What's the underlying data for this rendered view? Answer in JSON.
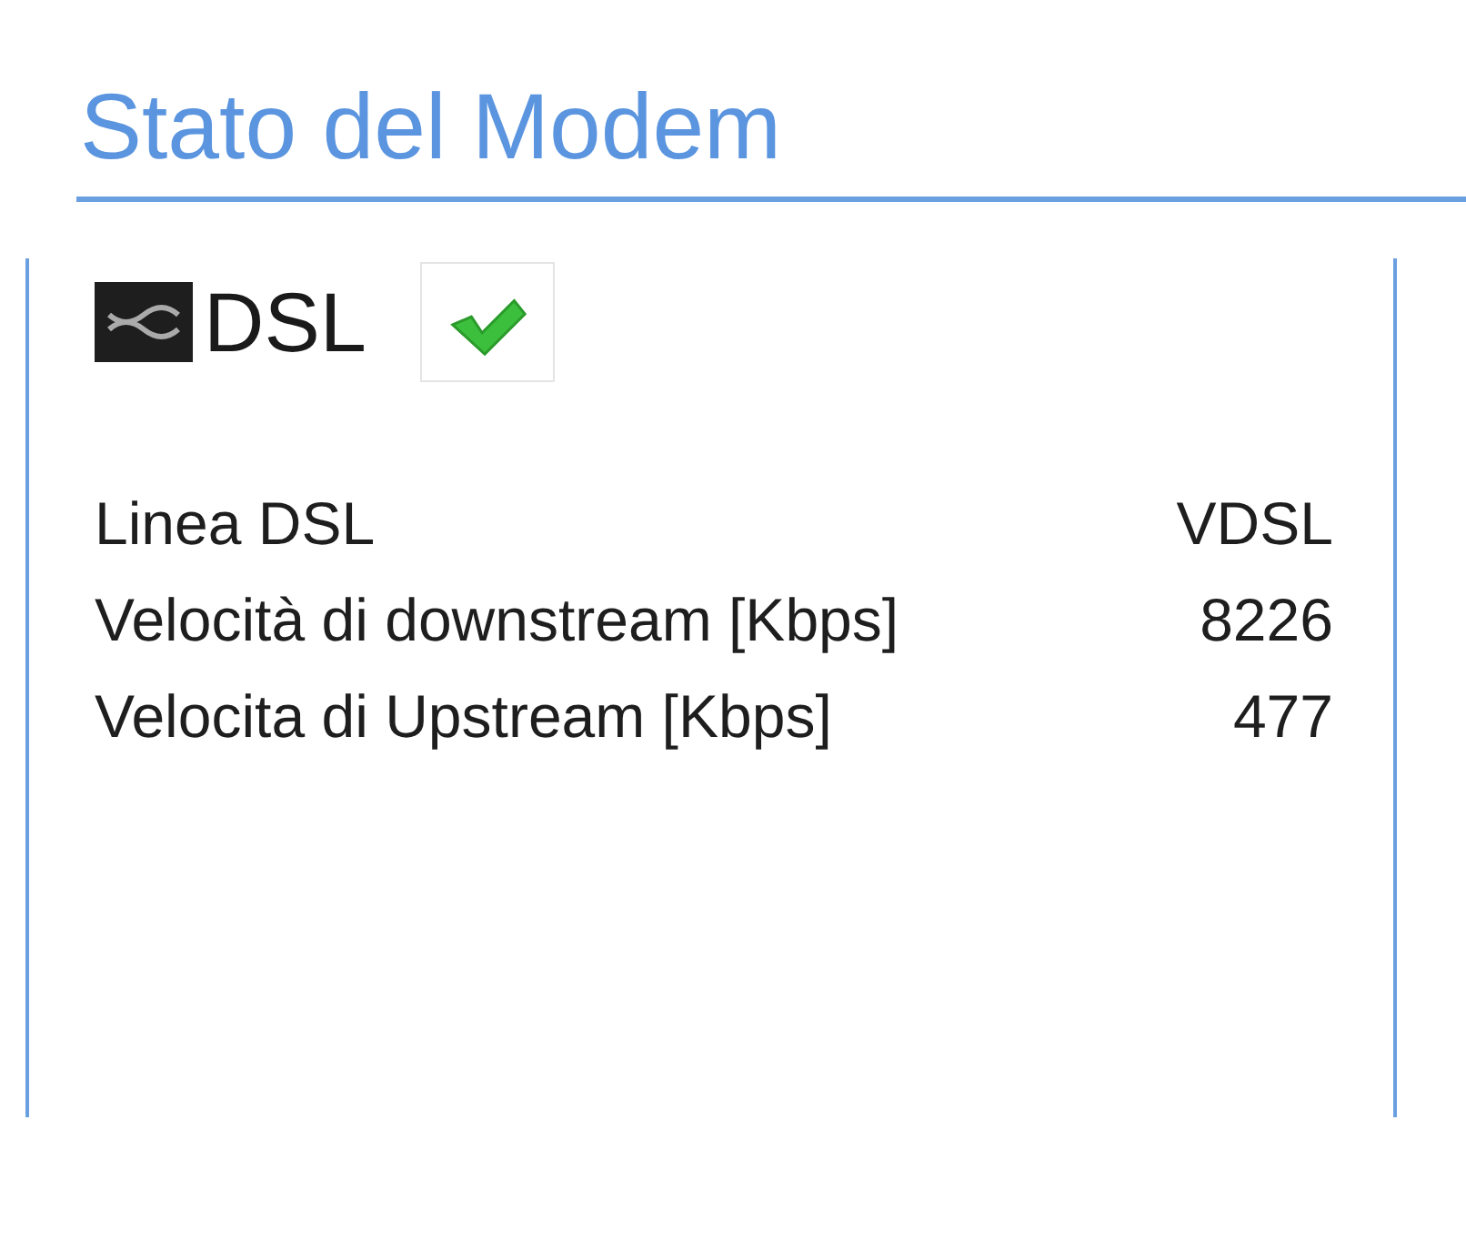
{
  "title": "Stato del Modem",
  "section": {
    "name": "DSL",
    "connected": true
  },
  "rows": [
    {
      "label": "Linea DSL",
      "value": "VDSL"
    },
    {
      "label": "Velocità di downstream [Kbps]",
      "value": "8226"
    },
    {
      "label": "Velocita di Upstream [Kbps]",
      "value": "477"
    }
  ]
}
